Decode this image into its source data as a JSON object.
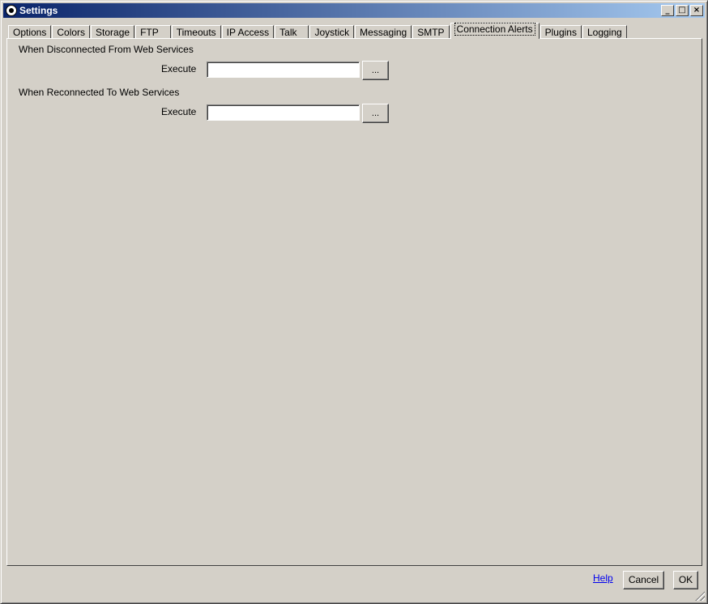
{
  "window": {
    "title": "Settings",
    "controls": {
      "minimize": "_",
      "maximize": "□",
      "close": "×"
    }
  },
  "tabs": [
    {
      "label": "Options"
    },
    {
      "label": "Colors"
    },
    {
      "label": "Storage"
    },
    {
      "label": "FTP"
    },
    {
      "label": "Timeouts"
    },
    {
      "label": "IP Access"
    },
    {
      "label": "Talk"
    },
    {
      "label": "Joystick"
    },
    {
      "label": "Messaging"
    },
    {
      "label": "SMTP"
    },
    {
      "label": "Connection Alerts",
      "active": true
    },
    {
      "label": "Plugins"
    },
    {
      "label": "Logging"
    }
  ],
  "panel": {
    "disconnected": {
      "heading": "When Disconnected From Web Services",
      "execute_label": "Execute",
      "execute_value": "",
      "browse_label": "..."
    },
    "reconnected": {
      "heading": "When Reconnected To Web Services",
      "execute_label": "Execute",
      "execute_value": "",
      "browse_label": "..."
    }
  },
  "footer": {
    "help_label": "Help",
    "cancel_label": "Cancel",
    "ok_label": "OK"
  },
  "colors": {
    "face": "#d4d0c8",
    "title_start": "#0a246a",
    "title_end": "#a6caf0",
    "link": "#0000ee"
  }
}
